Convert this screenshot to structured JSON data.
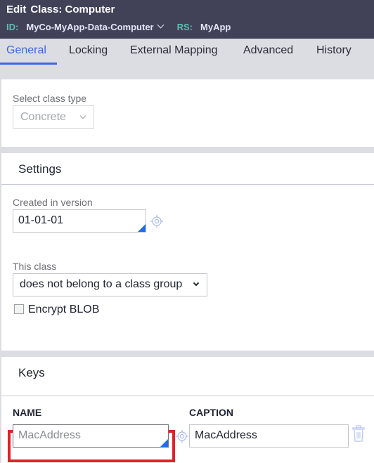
{
  "header": {
    "edit_label": "Edit",
    "title": "Class: Computer",
    "id_key": "ID:",
    "id_value": "MyCo-MyApp-Data-Computer",
    "rs_key": "RS:",
    "rs_value": "MyApp"
  },
  "tabs": [
    {
      "label": "General",
      "active": true
    },
    {
      "label": "Locking",
      "active": false
    },
    {
      "label": "External Mapping",
      "active": false
    },
    {
      "label": "Advanced",
      "active": false
    },
    {
      "label": "History",
      "active": false
    }
  ],
  "class_type": {
    "label": "Select class type",
    "value": "Concrete",
    "disabled": true
  },
  "settings": {
    "title": "Settings",
    "created_label": "Created in version",
    "created_value": "01-01-01",
    "class_group_label": "This class",
    "class_group_value": "does not belong to a class group",
    "encrypt_label": "Encrypt BLOB",
    "encrypt_checked": false
  },
  "keys": {
    "title": "Keys",
    "name_header": "NAME",
    "caption_header": "CAPTION",
    "rows": [
      {
        "name_placeholder": "MacAddress",
        "caption_value": "MacAddress"
      }
    ]
  },
  "colors": {
    "header_bg": "#414258",
    "accent": "#3d67e4",
    "highlight": "#e3212a",
    "meta_key": "#5fbdb2"
  }
}
